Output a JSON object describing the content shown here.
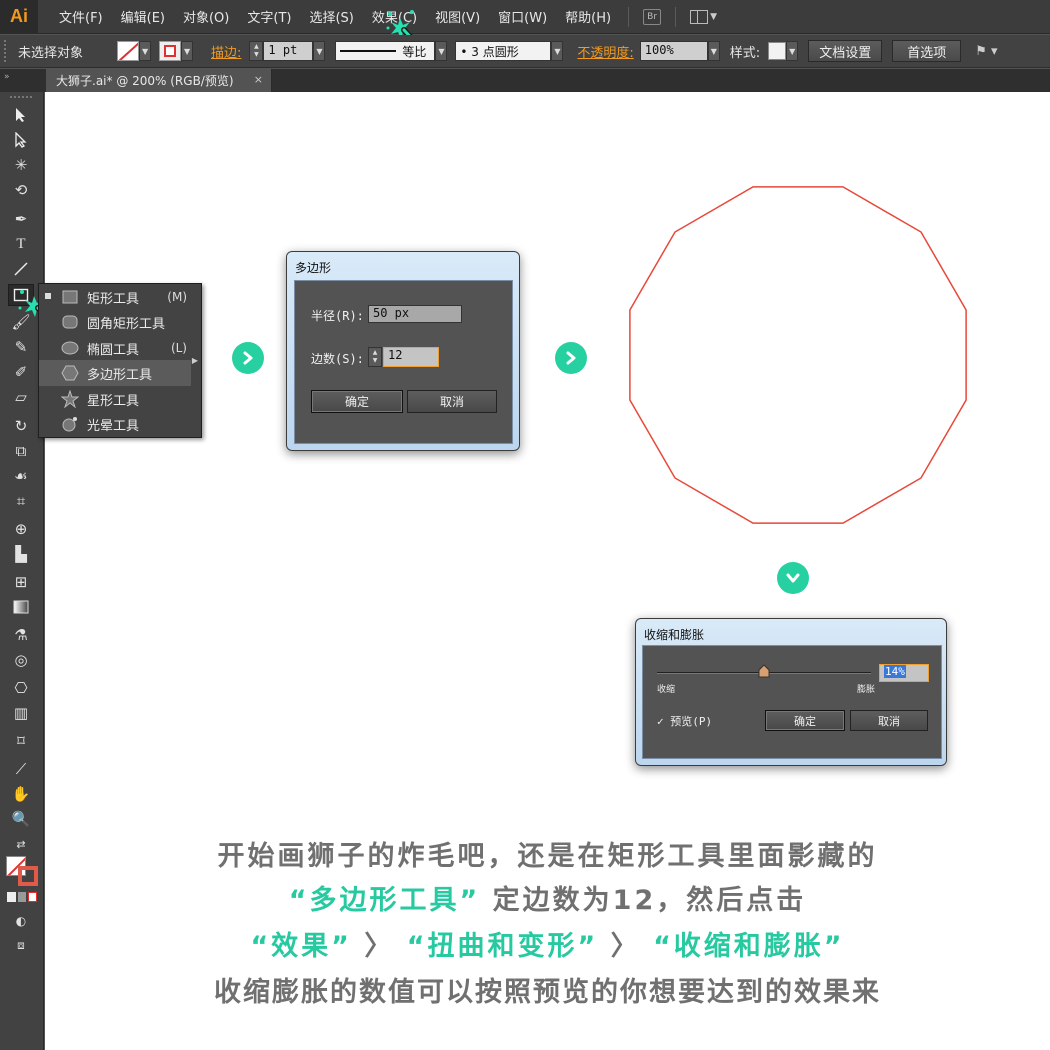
{
  "app": {
    "logo": "Ai"
  },
  "menu": {
    "items": [
      "文件(F)",
      "编辑(E)",
      "对象(O)",
      "文字(T)",
      "选择(S)",
      "效果(C)",
      "视图(V)",
      "窗口(W)",
      "帮助(H)"
    ],
    "bridge_label": "Br"
  },
  "controlbar": {
    "selection": "未选择对象",
    "stroke_label": "描边:",
    "stroke_weight": "1 pt",
    "stroke_profile": "等比",
    "brush": "• 3 点圆形",
    "opacity_label": "不透明度:",
    "opacity_value": "100%",
    "style_label": "样式:",
    "doc_setup": "文档设置",
    "preferences": "首选项"
  },
  "document_tab": {
    "title": "大狮子.ai* @ 200% (RGB/预览)",
    "close": "×"
  },
  "flyout": {
    "items": [
      {
        "label": "矩形工具",
        "key": "(M)",
        "icon": "rectangle-icon"
      },
      {
        "label": "圆角矩形工具",
        "key": "",
        "icon": "rounded-rectangle-icon"
      },
      {
        "label": "椭圆工具",
        "key": "(L)",
        "icon": "ellipse-icon"
      },
      {
        "label": "多边形工具",
        "key": "",
        "icon": "polygon-icon"
      },
      {
        "label": "星形工具",
        "key": "",
        "icon": "star-icon"
      },
      {
        "label": "光晕工具",
        "key": "",
        "icon": "flare-icon"
      }
    ]
  },
  "polygon_dialog": {
    "title": "多边形",
    "radius_label": "半径(R):",
    "radius_value": "50 px",
    "sides_label": "边数(S):",
    "sides_value": "12",
    "ok": "确定",
    "cancel": "取消"
  },
  "pucker_dialog": {
    "title": "收缩和膨胀",
    "left_label": "收缩",
    "right_label": "膨胀",
    "value": "14%",
    "slider_fraction": 0.5,
    "preview_label": "✓ 预览(P)",
    "ok": "确定",
    "cancel": "取消"
  },
  "caption": {
    "line1": "开始画狮子的炸毛吧，还是在矩形工具里面影藏的",
    "line2_hl": "“多边形工具”",
    "line2_rest": "定边数为12，然后点击",
    "line3_a": "“效果”",
    "line3_sep1": "〉",
    "line3_b": "“扭曲和变形”",
    "line3_sep2": "〉",
    "line3_c": "“收缩和膨胀”",
    "line4": "收缩膨胀的数值可以按照预览的你想要达到的效果来"
  },
  "colors": {
    "accent": "#27d0a0",
    "polygon_stroke": "#e8483a",
    "ai_orange": "#f29a1f"
  }
}
